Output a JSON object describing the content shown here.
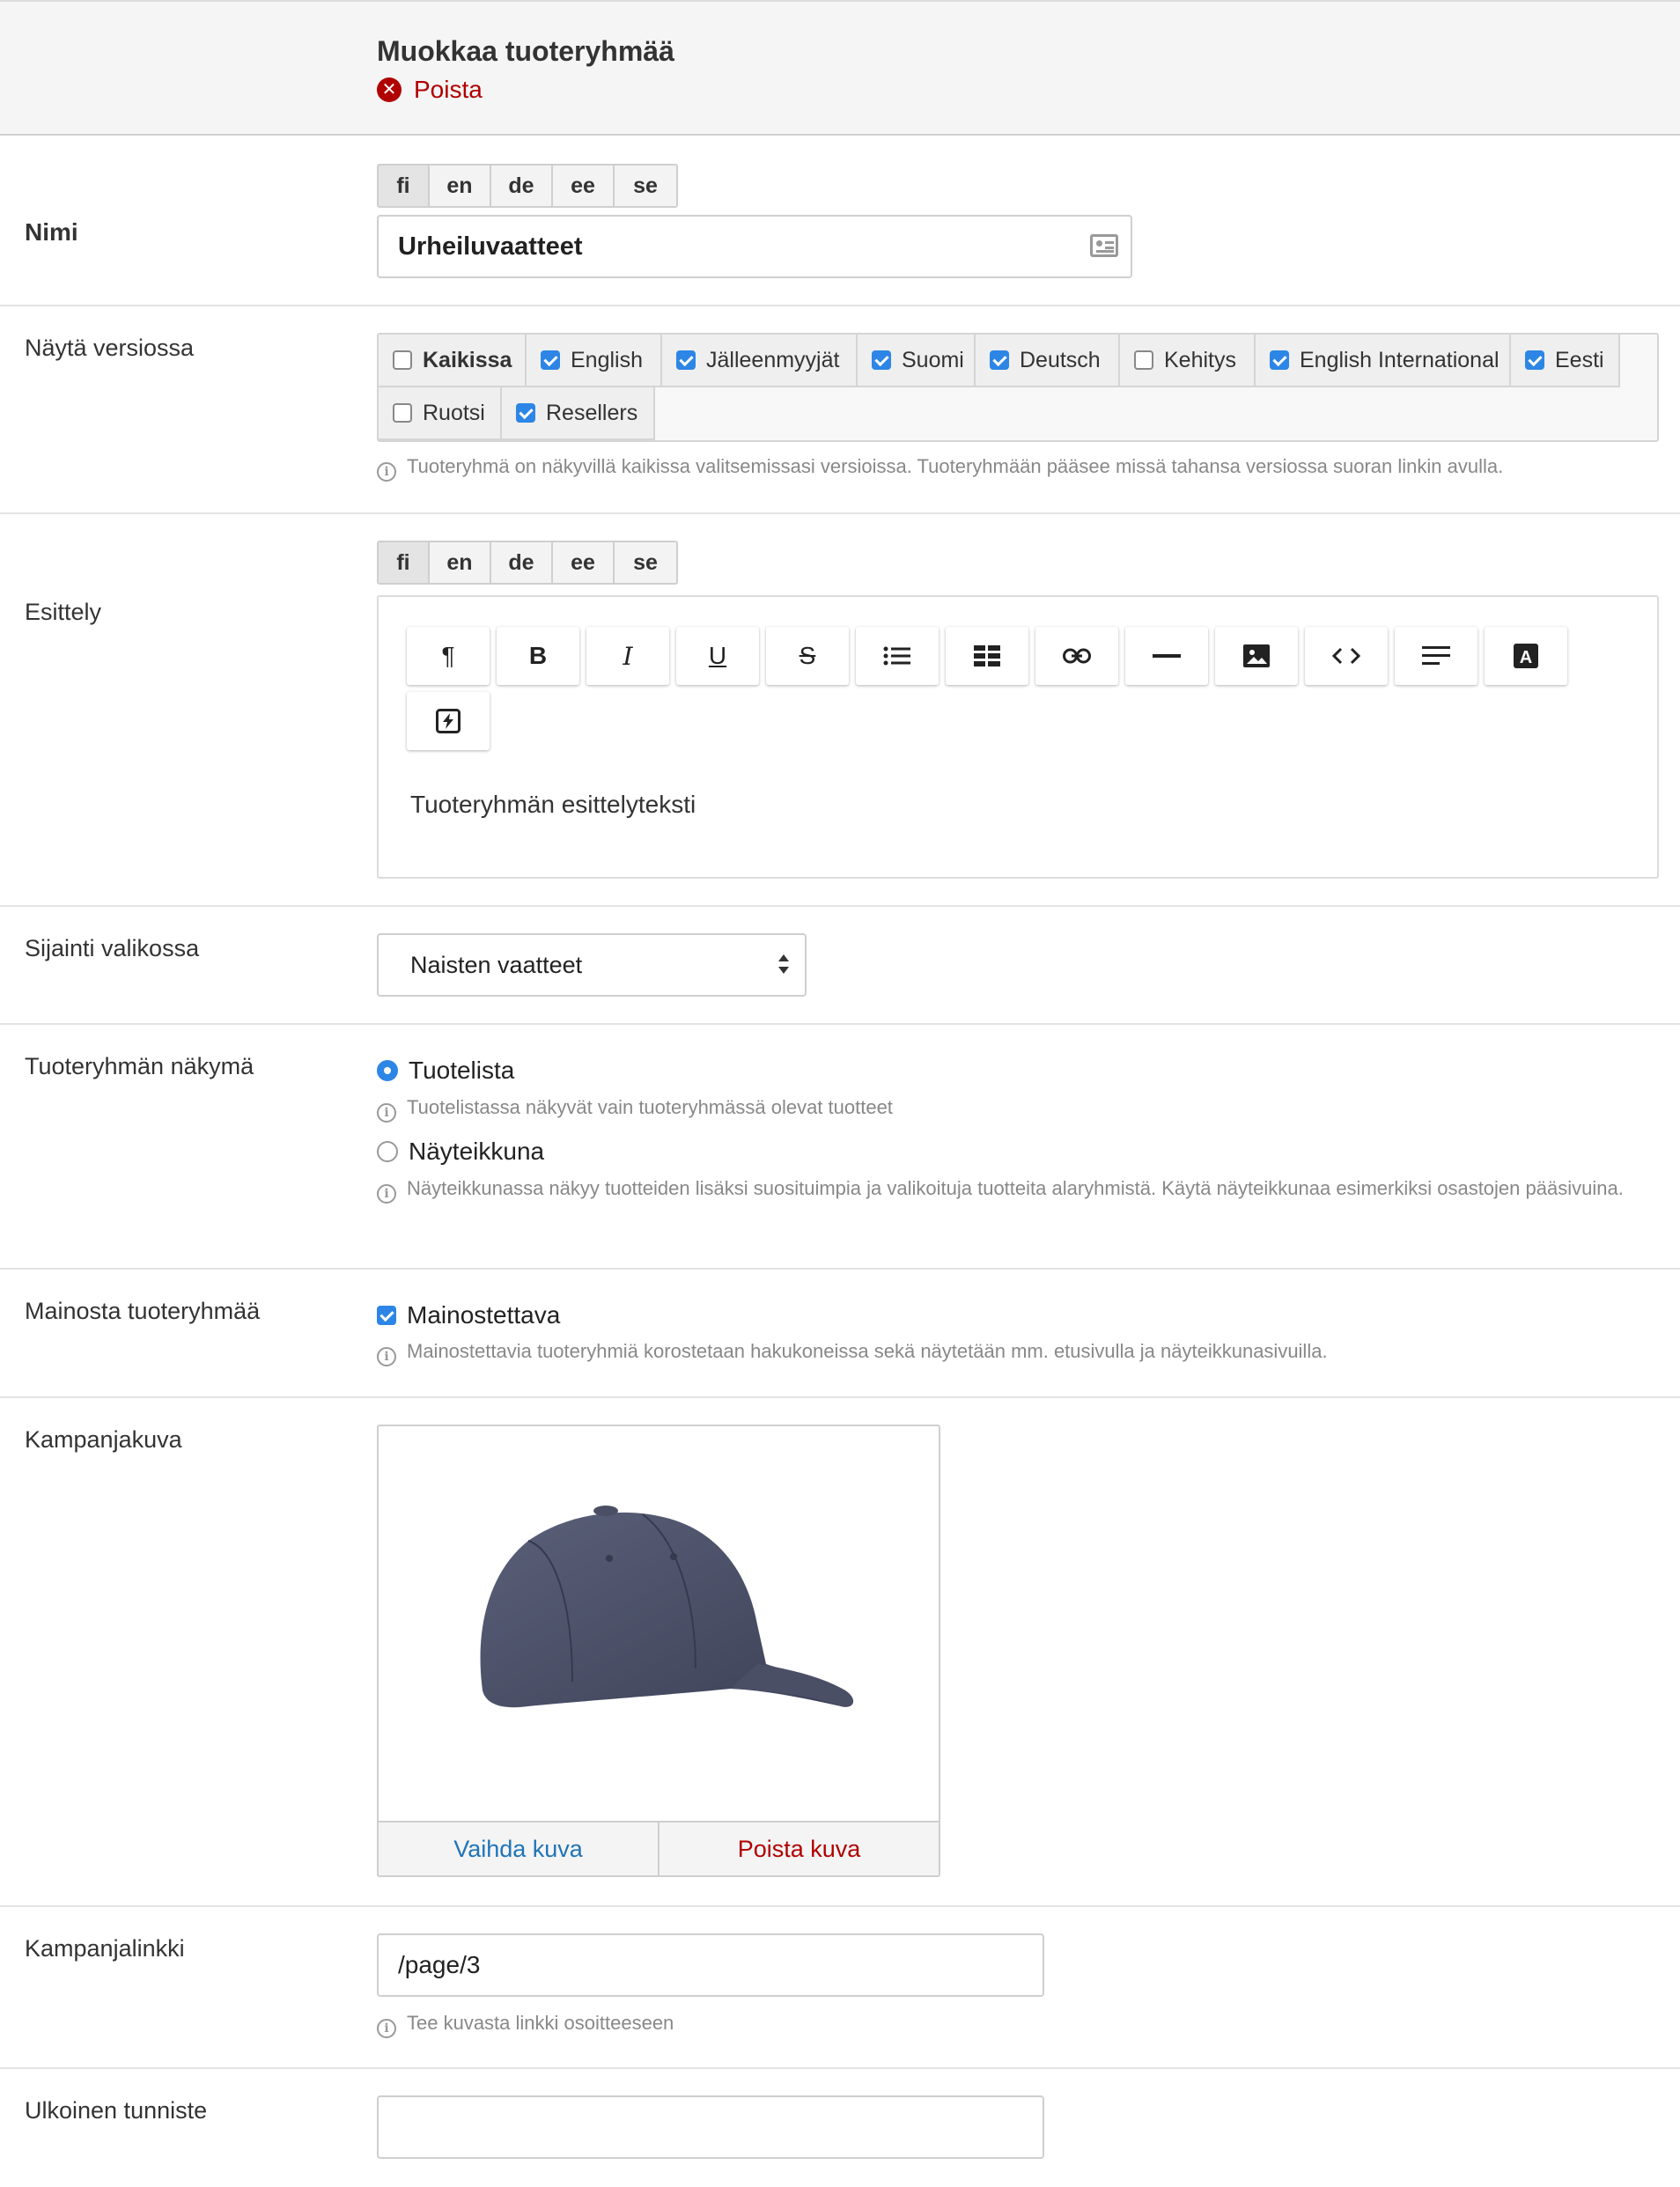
{
  "header": {
    "title": "Muokkaa tuoteryhmää",
    "delete_label": "Poista"
  },
  "languages": [
    "fi",
    "en",
    "de",
    "ee",
    "se"
  ],
  "name": {
    "label": "Nimi",
    "value": "Urheiluvaatteet"
  },
  "versions": {
    "label": "Näytä versiossa",
    "items": [
      {
        "label": "Kaikissa",
        "checked": false,
        "bold": true
      },
      {
        "label": "English",
        "checked": true
      },
      {
        "label": "Jälleenmyyjät",
        "checked": true
      },
      {
        "label": "Suomi",
        "checked": true
      },
      {
        "label": "Deutsch",
        "checked": true
      },
      {
        "label": "Kehitys",
        "checked": false
      },
      {
        "label": "English International",
        "checked": true
      },
      {
        "label": "Eesti",
        "checked": true
      },
      {
        "label": "Ruotsi",
        "checked": false
      },
      {
        "label": "Resellers",
        "checked": true
      }
    ],
    "help": "Tuoteryhmä on näkyvillä kaikissa valitsemissasi versioissa. Tuoteryhmään pääsee missä tahansa versiossa suoran linkin avulla."
  },
  "intro": {
    "label": "Esittely",
    "toolbar": [
      "paragraph-icon",
      "bold-icon",
      "italic-icon",
      "underline-icon",
      "strikethrough-icon",
      "list-icon",
      "table-icon",
      "link-icon",
      "horizontal-rule-icon",
      "image-icon",
      "code-icon",
      "align-icon",
      "text-color-icon",
      "clear-format-icon"
    ],
    "body": "Tuoteryhmän esittelyteksti"
  },
  "location": {
    "label": "Sijainti valikossa",
    "value": "Naisten vaatteet"
  },
  "view": {
    "label": "Tuoteryhmän näkymä",
    "option1": {
      "label": "Tuotelista",
      "checked": true,
      "help": "Tuotelistassa näkyvät vain tuoteryhmässä olevat tuotteet"
    },
    "option2": {
      "label": "Näyteikkuna",
      "checked": false,
      "help": "Näyteikkunassa näkyy tuotteiden lisäksi suosituimpia ja valikoituja tuotteita alaryhmistä. Käytä näyteikkunaa esimerkiksi osastojen pääsivuina."
    }
  },
  "promote": {
    "label": "Mainosta tuoteryhmää",
    "checkbox_label": "Mainostettava",
    "checked": true,
    "help": "Mainostettavia tuoteryhmiä korostetaan hakukoneissa sekä näytetään mm. etusivulla ja näyteikkunasivuilla."
  },
  "campaign_image": {
    "label": "Kampanjakuva",
    "change_label": "Vaihda kuva",
    "remove_label": "Poista kuva"
  },
  "campaign_link": {
    "label": "Kampanjalinkki",
    "value": "/page/3",
    "help": "Tee kuvasta linkki osoitteeseen"
  },
  "external_id": {
    "label": "Ulkoinen tunniste",
    "value": ""
  },
  "colors": {
    "accent": "#2d86e6",
    "danger": "#b00000",
    "link": "#1f74b8"
  }
}
